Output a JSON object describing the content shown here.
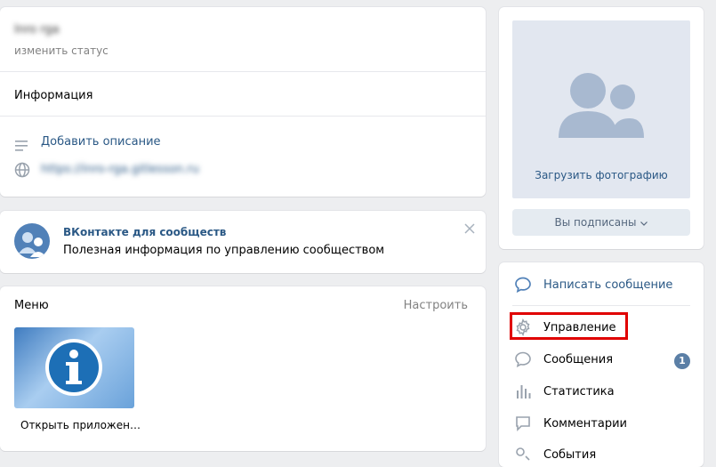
{
  "profile": {
    "name": "Inro rga",
    "status_link": "изменить статус",
    "info_heading": "Информация",
    "add_description": "Добавить описание",
    "website": "https://inro-rga.gitlesson.ru"
  },
  "promo": {
    "title": "ВКонтакте для сообществ",
    "text": "Полезная информация по управлению сообществом"
  },
  "menu": {
    "title": "Меню",
    "configure": "Настроить",
    "app_label": "Открыть приложен…"
  },
  "photo": {
    "upload": "Загрузить фотографию",
    "subscribed": "Вы подписаны"
  },
  "actions": {
    "write_message": "Написать сообщение",
    "items": [
      {
        "label": "Управление",
        "icon": "gear-icon"
      },
      {
        "label": "Сообщения",
        "icon": "chat-bubble-icon",
        "badge": "1"
      },
      {
        "label": "Статистика",
        "icon": "stats-icon"
      },
      {
        "label": "Комментарии",
        "icon": "comment-icon"
      },
      {
        "label": "События",
        "icon": "events-icon"
      }
    ]
  },
  "colors": {
    "accent": "#2a5885",
    "highlight": "#e00000",
    "placeholder": "#e2e7f0",
    "avatar": "#a8b9d0"
  }
}
